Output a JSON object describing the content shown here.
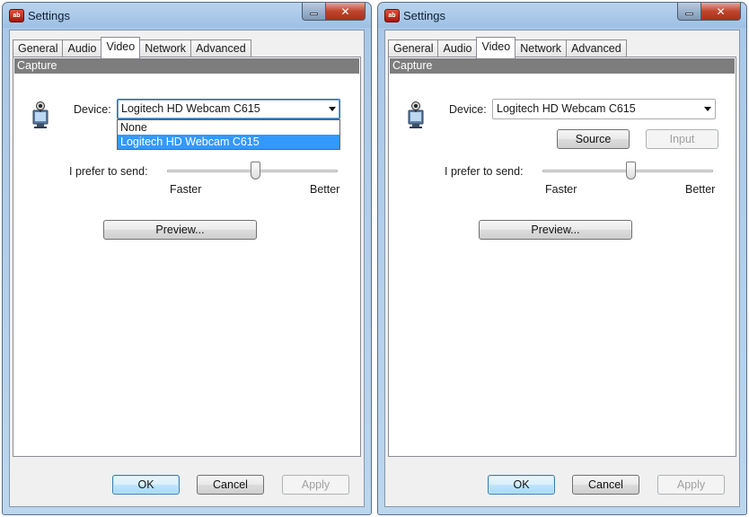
{
  "windows": [
    {
      "title": "Settings",
      "tabs": [
        "General",
        "Audio",
        "Video",
        "Network",
        "Advanced"
      ],
      "active_tab": "Video",
      "section_header": "Capture",
      "device_label": "Device:",
      "device_value": "Logitech HD Webcam C615",
      "dropdown_open": true,
      "dropdown_options": [
        "None",
        "Logitech HD Webcam C615"
      ],
      "dropdown_selected": "Logitech HD Webcam C615",
      "pref_label": "I prefer to send:",
      "slider_min_label": "Faster",
      "slider_max_label": "Better",
      "slider_value": 0.52,
      "preview_label": "Preview...",
      "ok_label": "OK",
      "cancel_label": "Cancel",
      "apply_label": "Apply"
    },
    {
      "title": "Settings",
      "tabs": [
        "General",
        "Audio",
        "Video",
        "Network",
        "Advanced"
      ],
      "active_tab": "Video",
      "section_header": "Capture",
      "device_label": "Device:",
      "device_value": "Logitech HD Webcam C615",
      "dropdown_open": false,
      "source_label": "Source",
      "input_label": "Input",
      "input_enabled": false,
      "pref_label": "I prefer to send:",
      "slider_min_label": "Faster",
      "slider_max_label": "Better",
      "slider_value": 0.52,
      "preview_label": "Preview...",
      "ok_label": "OK",
      "cancel_label": "Cancel",
      "apply_label": "Apply"
    }
  ],
  "icons": {
    "app": "app-logo-icon",
    "minimize": "minimize-icon",
    "close": "close-icon",
    "device": "webcam-icon",
    "dropdown": "chevron-down-icon"
  },
  "colors": {
    "section_header_bg": "#7d7d7d",
    "selection_bg": "#3399ff",
    "close_button": "#c1452d",
    "titlebar": "#b9d3ee"
  }
}
